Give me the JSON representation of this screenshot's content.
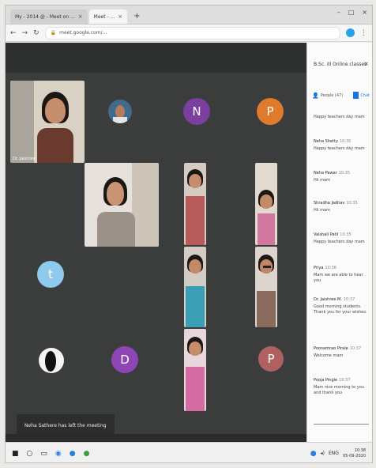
{
  "browser": {
    "tabs": [
      {
        "label": "My - 2014 @ - Meet on ...",
        "active": false
      },
      {
        "label": "Meet - ...",
        "active": true
      }
    ],
    "new_tab_label": "+",
    "address": "meet.google.com/...",
    "window_controls": [
      "–",
      "□",
      "×"
    ]
  },
  "meet": {
    "tiles": [
      {
        "type": "video",
        "name": "Dr. Jaishree"
      },
      {
        "type": "avatar",
        "letter": "N",
        "color": "#7b3fa0"
      },
      {
        "type": "avatar",
        "letter": "P",
        "color": "#e07a2c"
      },
      {
        "type": "avatar",
        "letter": "t",
        "color": "#8fc9ec"
      },
      {
        "type": "avatar",
        "letter": "D",
        "color": "#8e45b5"
      },
      {
        "type": "avatar",
        "letter": "P",
        "color": "#b06060"
      }
    ],
    "toast": "Neha Sathere has left the meeting"
  },
  "panel": {
    "title": "B.Sc. III Online classes",
    "close_label": "×",
    "tabs": [
      {
        "label": "People (47)",
        "icon": "people-icon"
      },
      {
        "label": "Chat",
        "icon": "chat-icon",
        "active": true
      }
    ],
    "messages": [
      {
        "sender": "",
        "time": "",
        "text": "Happy teachers day mam"
      },
      {
        "sender": "Neha Shetty",
        "time": "10:35",
        "text": "Happy teachers day mam"
      },
      {
        "sender": "Neha Pawar",
        "time": "10:35",
        "text": "Hii mam"
      },
      {
        "sender": "Shradha Jadhav",
        "time": "10:35",
        "text": "Hii mam"
      },
      {
        "sender": "Vaishali Patil",
        "time": "10:35",
        "text": "Happy teachers day mam"
      },
      {
        "sender": "Priya",
        "time": "10:36",
        "text": "Mam we are able to hear you"
      },
      {
        "sender": "Dr. Jaishree M.",
        "time": "10:37",
        "text": "Good morning students. Thank you for your wishes."
      },
      {
        "sender": "Poonamrao Pirale",
        "time": "10:37",
        "text": "Welcome mam"
      },
      {
        "sender": "Pooja Pingle",
        "time": "10:37",
        "text": "Mam nice morning to you and thank you"
      }
    ]
  },
  "taskbar": {
    "clock_time": "10:38",
    "clock_date": "05-09-2020",
    "tray_label": "ENG"
  }
}
